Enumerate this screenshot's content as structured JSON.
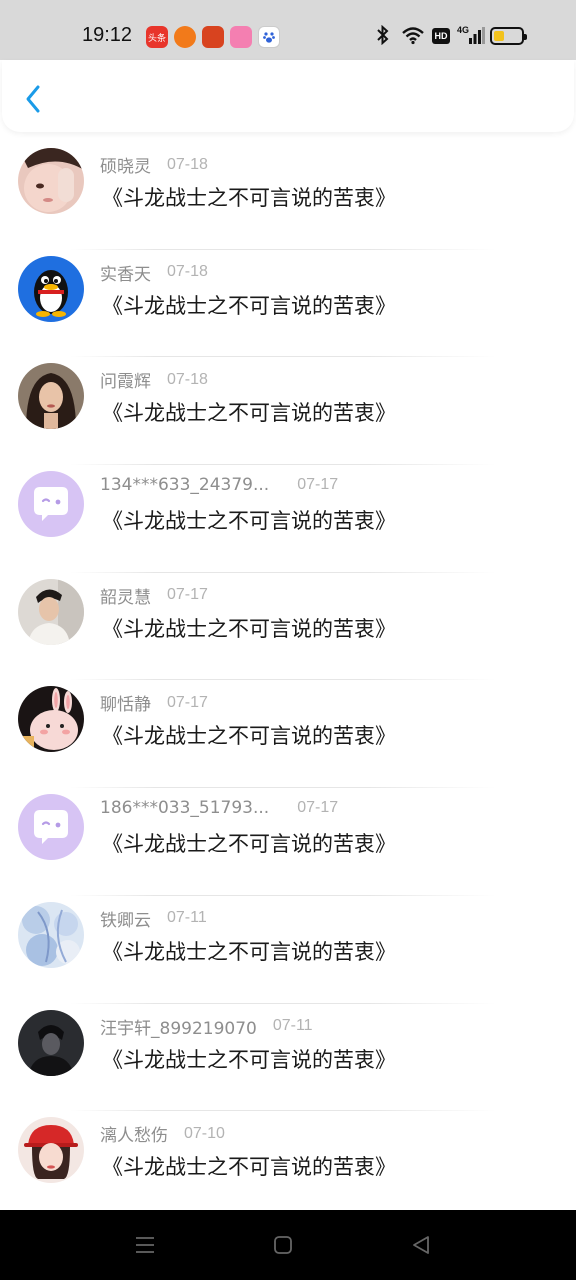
{
  "status_bar": {
    "time": "19:12",
    "notification_icons": [
      "toutiao-app-icon",
      "taobao-app-icon",
      "game-app-icon",
      "photo-app-icon",
      "baidu-app-icon"
    ],
    "toutiao_label": "头条",
    "network_label": "4G",
    "hd_label": "HD"
  },
  "header": {
    "back_icon": "chevron-left-icon",
    "accent_color": "#1a9be8"
  },
  "comments": [
    {
      "name": "硕晓灵",
      "date": "07-18",
      "text": "《斗龙战士之不可言说的苦衷》",
      "avatar": "photo-girl"
    },
    {
      "name": "实香天",
      "date": "07-18",
      "text": "《斗龙战士之不可言说的苦衷》",
      "avatar": "qq-penguin"
    },
    {
      "name": "问霞辉",
      "date": "07-18",
      "text": "《斗龙战士之不可言说的苦衷》",
      "avatar": "photo-woman"
    },
    {
      "name": "134***633_24379...",
      "date": "07-17",
      "text": "《斗龙战士之不可言说的苦衷》",
      "avatar": "default-chat"
    },
    {
      "name": "韶灵慧",
      "date": "07-17",
      "text": "《斗龙战士之不可言说的苦衷》",
      "avatar": "photo-man"
    },
    {
      "name": "聊恬静",
      "date": "07-17",
      "text": "《斗龙战士之不可言说的苦衷》",
      "avatar": "cartoon-bunny"
    },
    {
      "name": "186***033_51793...",
      "date": "07-17",
      "text": "《斗龙战士之不可言说的苦衷》",
      "avatar": "default-chat"
    },
    {
      "name": "铁卿云",
      "date": "07-11",
      "text": "《斗龙战士之不可言说的苦衷》",
      "avatar": "anime-art"
    },
    {
      "name": "汪宇轩_899219070",
      "date": "07-11",
      "text": "《斗龙战士之不可言说的苦衷》",
      "avatar": "dark-figure"
    },
    {
      "name": "漓人愁伤",
      "date": "07-10",
      "text": "《斗龙战士之不可言说的苦衷》",
      "avatar": "girl-red-hat"
    }
  ],
  "nav_bar": {
    "icons": [
      "menu-icon",
      "home-square-icon",
      "back-triangle-icon"
    ]
  }
}
